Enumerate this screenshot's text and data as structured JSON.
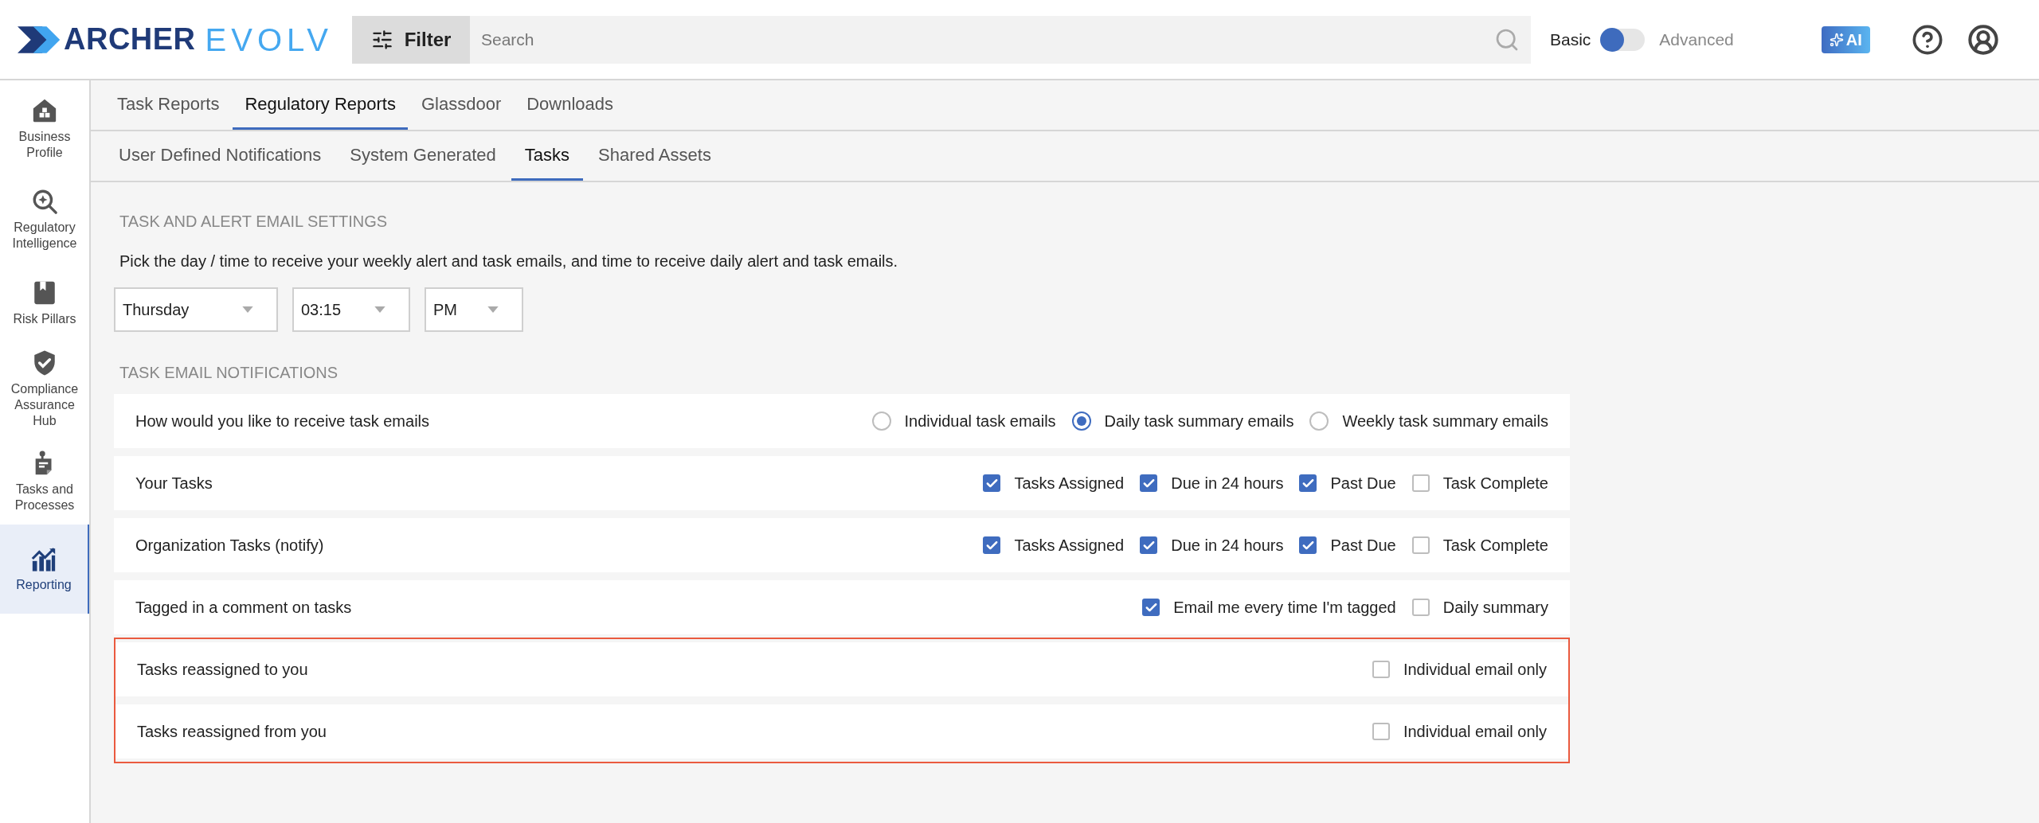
{
  "header": {
    "logo": {
      "brand": "ARCHER",
      "product": "EVOLV"
    },
    "filter_button": "Filter",
    "search": {
      "placeholder": "Search"
    },
    "mode_toggle": {
      "left_label": "Basic",
      "right_label": "Advanced",
      "advanced": false
    },
    "ai_button": "AI"
  },
  "sidebar": {
    "items": [
      {
        "label": "Business Profile",
        "selected": false
      },
      {
        "label": "Regulatory Intelligence",
        "selected": false
      },
      {
        "label": "Risk Pillars",
        "selected": false
      },
      {
        "label": "Compliance Assurance Hub",
        "selected": false
      },
      {
        "label": "Tasks and Processes",
        "selected": false
      },
      {
        "label": "Reporting",
        "selected": true
      }
    ]
  },
  "tabs": [
    {
      "label": "Task Reports",
      "selected": false
    },
    {
      "label": "Regulatory Reports",
      "selected": true
    },
    {
      "label": "Glassdoor",
      "selected": false
    },
    {
      "label": "Downloads",
      "selected": false
    }
  ],
  "subtabs": [
    {
      "label": "User Defined Notifications",
      "selected": false
    },
    {
      "label": "System Generated",
      "selected": false
    },
    {
      "label": "Tasks",
      "selected": true
    },
    {
      "label": "Shared Assets",
      "selected": false
    }
  ],
  "email_settings": {
    "heading": "TASK AND ALERT EMAIL SETTINGS",
    "description": "Pick the day / time to receive your weekly alert and task emails, and time to receive daily alert and task emails.",
    "dropdowns": [
      "Thursday",
      "03:15",
      "PM"
    ]
  },
  "notifications": {
    "heading": "TASK EMAIL NOTIFICATIONS",
    "rows": [
      {
        "label": "How would you like to receive task emails",
        "kind": "radio",
        "highlighted": false,
        "options": [
          {
            "label": "Individual task emails",
            "selected": false
          },
          {
            "label": "Daily task summary emails",
            "selected": true
          },
          {
            "label": "Weekly task summary emails",
            "selected": false
          }
        ]
      },
      {
        "label": "Your Tasks",
        "kind": "checkbox",
        "highlighted": false,
        "options": [
          {
            "label": "Tasks Assigned",
            "checked": true
          },
          {
            "label": "Due in 24 hours",
            "checked": true
          },
          {
            "label": "Past Due",
            "checked": true
          },
          {
            "label": "Task Complete",
            "checked": false
          }
        ]
      },
      {
        "label": "Organization Tasks (notify)",
        "kind": "checkbox",
        "highlighted": false,
        "options": [
          {
            "label": "Tasks Assigned",
            "checked": true
          },
          {
            "label": "Due in 24 hours",
            "checked": true
          },
          {
            "label": "Past Due",
            "checked": true
          },
          {
            "label": "Task Complete",
            "checked": false
          }
        ]
      },
      {
        "label": "Tagged in a comment on tasks",
        "kind": "checkbox",
        "highlighted": false,
        "options": [
          {
            "label": "Email me every time I'm tagged",
            "checked": true
          },
          {
            "label": "Daily summary",
            "checked": false
          }
        ]
      },
      {
        "label": "Tasks reassigned to you",
        "kind": "checkbox",
        "highlighted": true,
        "options": [
          {
            "label": "Individual email only",
            "checked": false
          }
        ]
      },
      {
        "label": "Tasks reassigned from you",
        "kind": "checkbox",
        "highlighted": true,
        "options": [
          {
            "label": "Individual email only",
            "checked": false
          }
        ]
      }
    ]
  }
}
